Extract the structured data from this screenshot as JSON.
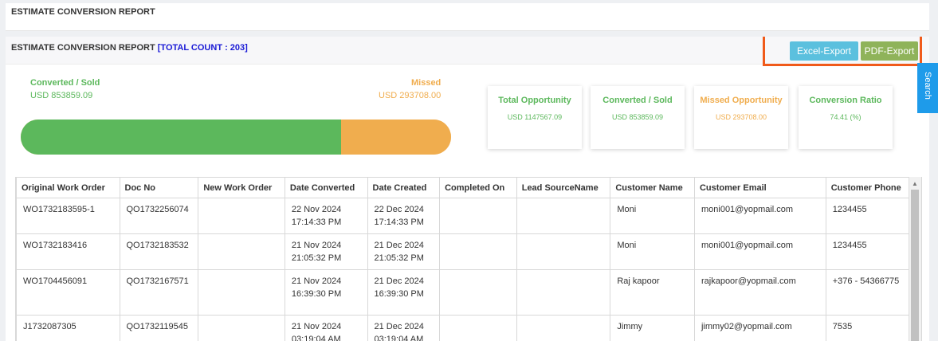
{
  "top_panel": {
    "title": "ESTIMATE CONVERSION REPORT"
  },
  "report": {
    "title": "ESTIMATE CONVERSION REPORT",
    "count_text": "[TOTAL COUNT : 203]",
    "excel_label": "Excel-Export",
    "pdf_label": "PDF-Export"
  },
  "search_tab": {
    "label": "Search"
  },
  "summary": {
    "sold_label": "Converted / Sold",
    "sold_value": "USD 853859.09",
    "missed_label": "Missed",
    "missed_value": "USD 293708.00",
    "sold_ratio": 0.7441
  },
  "cards": [
    {
      "title": "Total Opportunity",
      "value": "USD 1147567.09",
      "color": "#5cb85c"
    },
    {
      "title": "Converted / Sold",
      "value": "USD 853859.09",
      "color": "#5cb85c"
    },
    {
      "title": "Missed Opportunity",
      "value": "USD 293708.00",
      "color": "#f0ad4e"
    },
    {
      "title": "Conversion Ratio",
      "value": "74.41 (%)",
      "color": "#5cb85c"
    }
  ],
  "table": {
    "columns": [
      "Original Work Order",
      "Doc No",
      "New Work Order",
      "Date Converted",
      "Date Created",
      "Completed On",
      "Lead SourceName",
      "Customer Name",
      "Customer Email",
      "Customer Phone"
    ],
    "rows": [
      {
        "original_wo": "WO1732183595-1",
        "doc_no": "QO1732256074",
        "new_wo": "",
        "date_converted": [
          "22 Nov 2024",
          "17:14:33 PM"
        ],
        "date_created": [
          "22 Dec 2024",
          "17:14:33 PM"
        ],
        "completed_on": "",
        "lead_source": "",
        "customer_name": "Moni",
        "customer_email": "moni001@yopmail.com",
        "customer_phone": "1234455"
      },
      {
        "original_wo": "WO1732183416",
        "doc_no": "QO1732183532",
        "new_wo": "",
        "date_converted": [
          "21 Nov 2024",
          "21:05:32 PM"
        ],
        "date_created": [
          "21 Dec 2024",
          "21:05:32 PM"
        ],
        "completed_on": "",
        "lead_source": "",
        "customer_name": "Moni",
        "customer_email": "moni001@yopmail.com",
        "customer_phone": "1234455"
      },
      {
        "original_wo": "WO1704456091",
        "doc_no": "QO1732167571",
        "new_wo": "",
        "date_converted": [
          "21 Nov 2024",
          "16:39:30 PM"
        ],
        "date_created": [
          "21 Dec 2024",
          "16:39:30 PM"
        ],
        "completed_on": "",
        "lead_source": "",
        "customer_name": "Raj kapoor",
        "customer_email": "rajkapoor@yopmail.com",
        "customer_phone": "+376 - 54366775"
      },
      {
        "original_wo": "J1732087305",
        "doc_no": "QO1732119545",
        "new_wo": "",
        "date_converted": [
          "21 Nov 2024",
          "03:19:04 AM"
        ],
        "date_created": [
          "21 Dec 2024",
          "03:19:04 AM"
        ],
        "completed_on": "",
        "lead_source": "",
        "customer_name": "Jimmy",
        "customer_email": "jimmy02@yopmail.com",
        "customer_phone": "7535"
      }
    ]
  }
}
